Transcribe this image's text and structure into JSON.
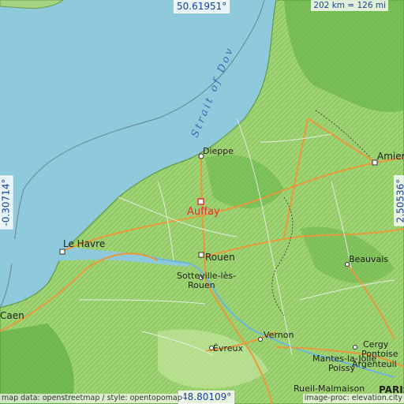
{
  "map": {
    "coordinates": {
      "top": "50.61951°",
      "bottom": "48.80109°",
      "left": "-0.30714°",
      "right": "2.50536°"
    },
    "scale": "202 km = 126 mi",
    "attribution_left": "map data: openstreetmap / style: opentopomap",
    "attribution_right": "image-proc: elevation.city",
    "sea_label": "Strait of Dov",
    "highlight_place": "Auffay",
    "places": [
      {
        "name": "Dieppe"
      },
      {
        "name": "Le Havre"
      },
      {
        "name": "Rouen"
      },
      {
        "name": "Sotteville-lès-"
      },
      {
        "name": "Rouen"
      },
      {
        "name": "Amiens"
      },
      {
        "name": "Beauvais"
      },
      {
        "name": "Évreux"
      },
      {
        "name": "Vernon"
      },
      {
        "name": "Caen"
      },
      {
        "name": "Cergy"
      },
      {
        "name": "Pontoise"
      },
      {
        "name": "Mantes-la-Jolie"
      },
      {
        "name": "Poissy"
      },
      {
        "name": "Argenteuil"
      },
      {
        "name": "Rueil-Malmaison"
      },
      {
        "name": "PARIS"
      }
    ]
  },
  "colors": {
    "sea": "#8fc9dc",
    "land_light": "#b8e08a",
    "land_green": "#6fbd4c",
    "road_major": "#e89a3a",
    "highlight": "#e0333a"
  }
}
